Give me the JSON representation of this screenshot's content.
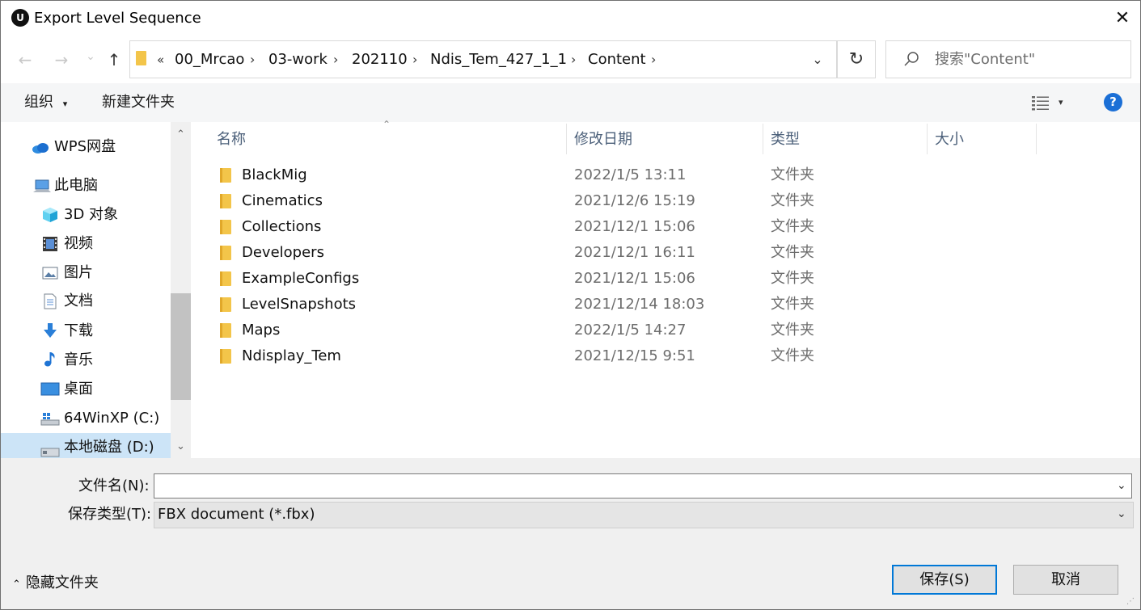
{
  "window": {
    "title": "Export Level Sequence",
    "app_icon_text": "U",
    "close_glyph": "✕"
  },
  "nav": {
    "back_glyph": "←",
    "forward_glyph": "→",
    "recent_glyph": "⌄",
    "up_glyph": "↑",
    "overflow_glyph": "«",
    "breadcrumbs": [
      "00_Mrcao",
      "03-work",
      "202110",
      "Ndis_Tem_427_1_1",
      "Content"
    ],
    "crumb_separator": "›",
    "address_dropdown_glyph": "⌄",
    "refresh_glyph": "↻",
    "search_placeholder": "搜索\"Content\""
  },
  "toolbar": {
    "organize_label": "组织",
    "organize_glyph": "▾",
    "new_folder_label": "新建文件夹",
    "view_dropdown_glyph": "▾",
    "help_glyph": "?"
  },
  "sidebar": {
    "items": [
      {
        "label": "WPS网盘",
        "icon": "cloud-icon"
      },
      {
        "label": "此电脑",
        "icon": "computer-icon"
      },
      {
        "label": "3D 对象",
        "icon": "3d-objects-icon"
      },
      {
        "label": "视频",
        "icon": "video-icon"
      },
      {
        "label": "图片",
        "icon": "pictures-icon"
      },
      {
        "label": "文档",
        "icon": "documents-icon"
      },
      {
        "label": "下载",
        "icon": "download-icon"
      },
      {
        "label": "音乐",
        "icon": "music-icon"
      },
      {
        "label": "桌面",
        "icon": "desktop-icon"
      },
      {
        "label": "64WinXP  (C:)",
        "icon": "system-drive-icon"
      },
      {
        "label": "本地磁盘 (D:)",
        "icon": "drive-icon",
        "selected": true
      }
    ],
    "scroll_up_glyph": "⌃",
    "scroll_down_glyph": "⌄"
  },
  "file_list": {
    "columns": {
      "name": "名称",
      "modified": "修改日期",
      "type": "类型",
      "size": "大小"
    },
    "sort_glyph": "⌃",
    "rows": [
      {
        "name": "BlackMig",
        "modified": "2022/1/5 13:11",
        "type": "文件夹"
      },
      {
        "name": "Cinematics",
        "modified": "2021/12/6 15:19",
        "type": "文件夹"
      },
      {
        "name": "Collections",
        "modified": "2021/12/1 15:06",
        "type": "文件夹"
      },
      {
        "name": "Developers",
        "modified": "2021/12/1 16:11",
        "type": "文件夹"
      },
      {
        "name": "ExampleConfigs",
        "modified": "2021/12/1 15:06",
        "type": "文件夹"
      },
      {
        "name": "LevelSnapshots",
        "modified": "2021/12/14 18:03",
        "type": "文件夹"
      },
      {
        "name": "Maps",
        "modified": "2022/1/5 14:27",
        "type": "文件夹"
      },
      {
        "name": "Ndisplay_Tem",
        "modified": "2021/12/15 9:51",
        "type": "文件夹"
      }
    ]
  },
  "bottom": {
    "filename_label": "文件名(N):",
    "filename_value": "",
    "filetype_label": "保存类型(T):",
    "filetype_value": "FBX document (*.fbx)",
    "dropdown_glyph": "⌄",
    "hide_folders_glyph": "⌃",
    "hide_folders_label": "隐藏文件夹",
    "save_label": "保存(S)",
    "cancel_label": "取消",
    "grip_glyph": "⋰"
  },
  "colors": {
    "accent": "#0078d7",
    "selected_bg": "#cce4f7",
    "folder": "#f3c54a",
    "header_text": "#4c607a",
    "help_badge": "#1b6fd6"
  }
}
